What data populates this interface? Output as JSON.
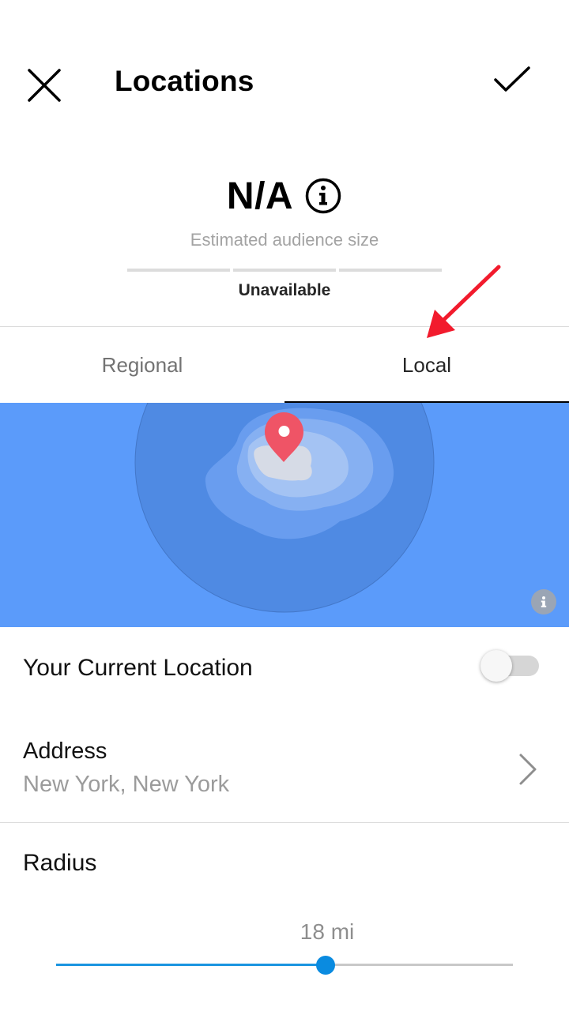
{
  "header": {
    "title": "Locations",
    "close_icon": "close-icon",
    "confirm_icon": "checkmark-icon"
  },
  "audience": {
    "value": "N/A",
    "label": "Estimated audience size",
    "availability": "Unavailable",
    "info_icon": "info-icon"
  },
  "tabs": [
    {
      "label": "Regional",
      "active": false
    },
    {
      "label": "Local",
      "active": true
    }
  ],
  "map": {
    "pin_icon": "location-pin-icon",
    "info_icon": "info-icon"
  },
  "current_location": {
    "label": "Your Current Location",
    "enabled": false
  },
  "address": {
    "label": "Address",
    "value": "New York, New York",
    "chevron_icon": "chevron-right-icon"
  },
  "radius": {
    "label": "Radius",
    "value_text": "18 mi",
    "slider_fraction": 0.59
  },
  "colors": {
    "map_water": "#5b9bfa",
    "radius_circle": "#4f8ae3",
    "pin": "#ef5466",
    "slider_accent": "#0a8be0",
    "annotation_arrow": "#f21b2d"
  }
}
